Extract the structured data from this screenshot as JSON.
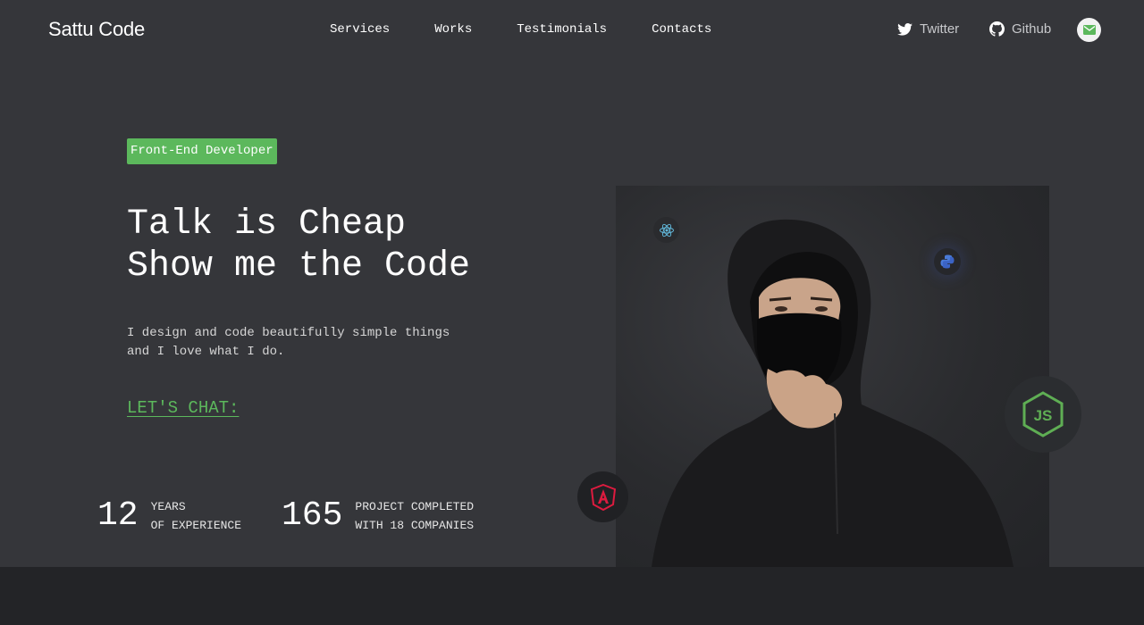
{
  "header": {
    "logo": "Sattu Code",
    "nav": [
      "Services",
      "Works",
      "Testimonials",
      "Contacts"
    ],
    "social": {
      "twitter_label": "Twitter",
      "github_label": "Github"
    },
    "mail_icon": "mail-icon"
  },
  "hero": {
    "badge": "Front-End Developer",
    "headline_line1": "Talk is Cheap",
    "headline_line2": "Show me the Code",
    "tagline_line1": "I design and code beautifully simple things",
    "tagline_line2": "and I love what I do.",
    "cta": "LET'S CHAT:"
  },
  "stats": [
    {
      "number": "12",
      "label_line1": "YEARS",
      "label_line2": "OF EXPERIENCE"
    },
    {
      "number": "165",
      "label_line1": "PROJECT COMPLETED",
      "label_line2": "WITH 18 COMPANIES"
    }
  ],
  "tech_icons": [
    "react-icon",
    "python-icon",
    "nodejs-icon",
    "angular-icon"
  ],
  "colors": {
    "accent": "#5cb85c",
    "background": "#35363a",
    "bottom_band": "#232427"
  }
}
